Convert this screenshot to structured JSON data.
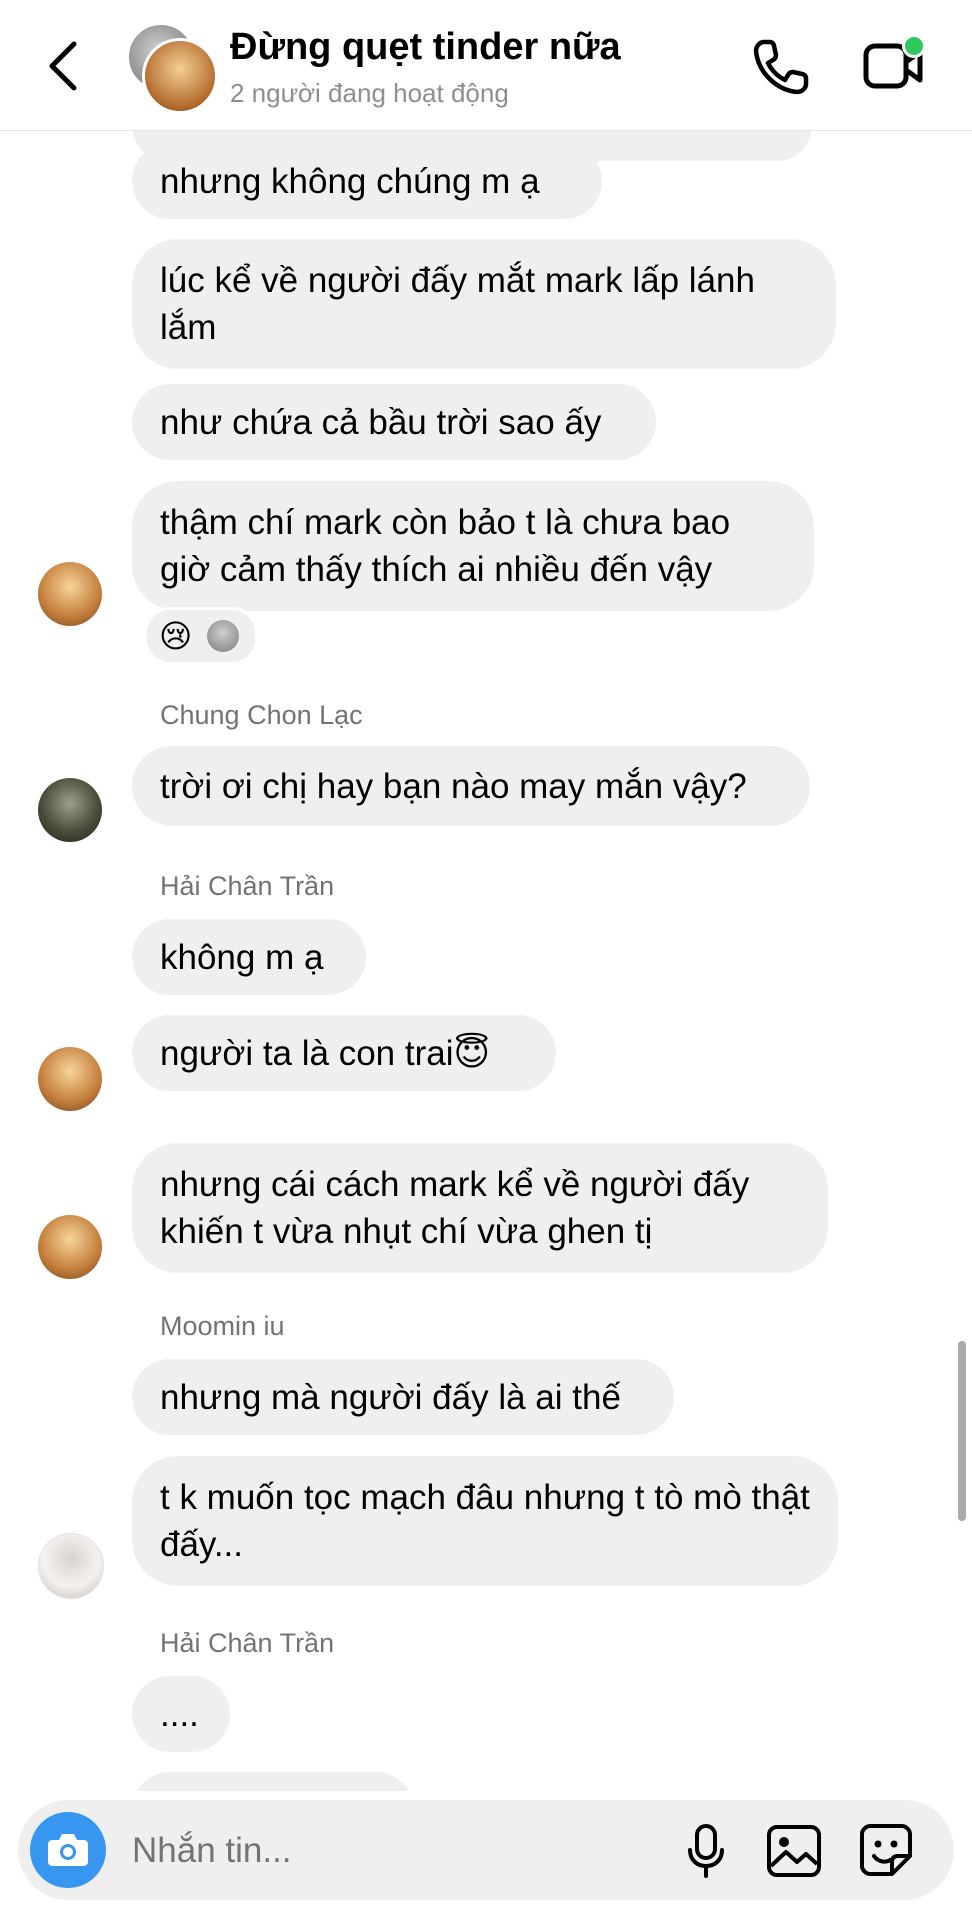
{
  "header": {
    "title": "Đừng quẹt tinder nữa",
    "subtitle": "2 người đang hoạt động"
  },
  "messages": [
    {
      "text": "nhưng không chúng m ạ"
    },
    {
      "text": "lúc kể về người đấy mắt mark lấp lánh lắm"
    },
    {
      "text": "như chứa cả bầu trời sao ấy"
    },
    {
      "text": "thậm chí mark còn bảo t là chưa bao giờ cảm thấy thích ai nhiều đến vậy"
    },
    {
      "sender": "Chung Chon Lạc",
      "text": "trời ơi chị hay bạn nào may mắn vậy?"
    },
    {
      "sender": "Hải Chân Trần",
      "text": "không m ạ"
    },
    {
      "text": "người ta là con trai😇"
    },
    {
      "text": "nhưng cái cách mark kể về người đấy khiến t vừa nhụt chí vừa ghen tị"
    },
    {
      "sender": "Moomin iu",
      "text": "nhưng mà người đấy là ai thế"
    },
    {
      "text": "t k muốn tọc mạch đâu nhưng t tò mò thật đấy..."
    },
    {
      "sender": "Hải Chân Trần",
      "text": "...."
    }
  ],
  "reaction": {
    "emoji": "😢"
  },
  "composer": {
    "placeholder": "Nhắn tin..."
  },
  "colors": {
    "accent": "#3797f0",
    "bubble": "#efefef",
    "online": "#2ec95c",
    "secondary_text": "#737373"
  },
  "icons": [
    "back-arrow-icon",
    "phone-icon",
    "video-camera-icon",
    "camera-icon",
    "microphone-icon",
    "gallery-icon",
    "sticker-icon"
  ]
}
